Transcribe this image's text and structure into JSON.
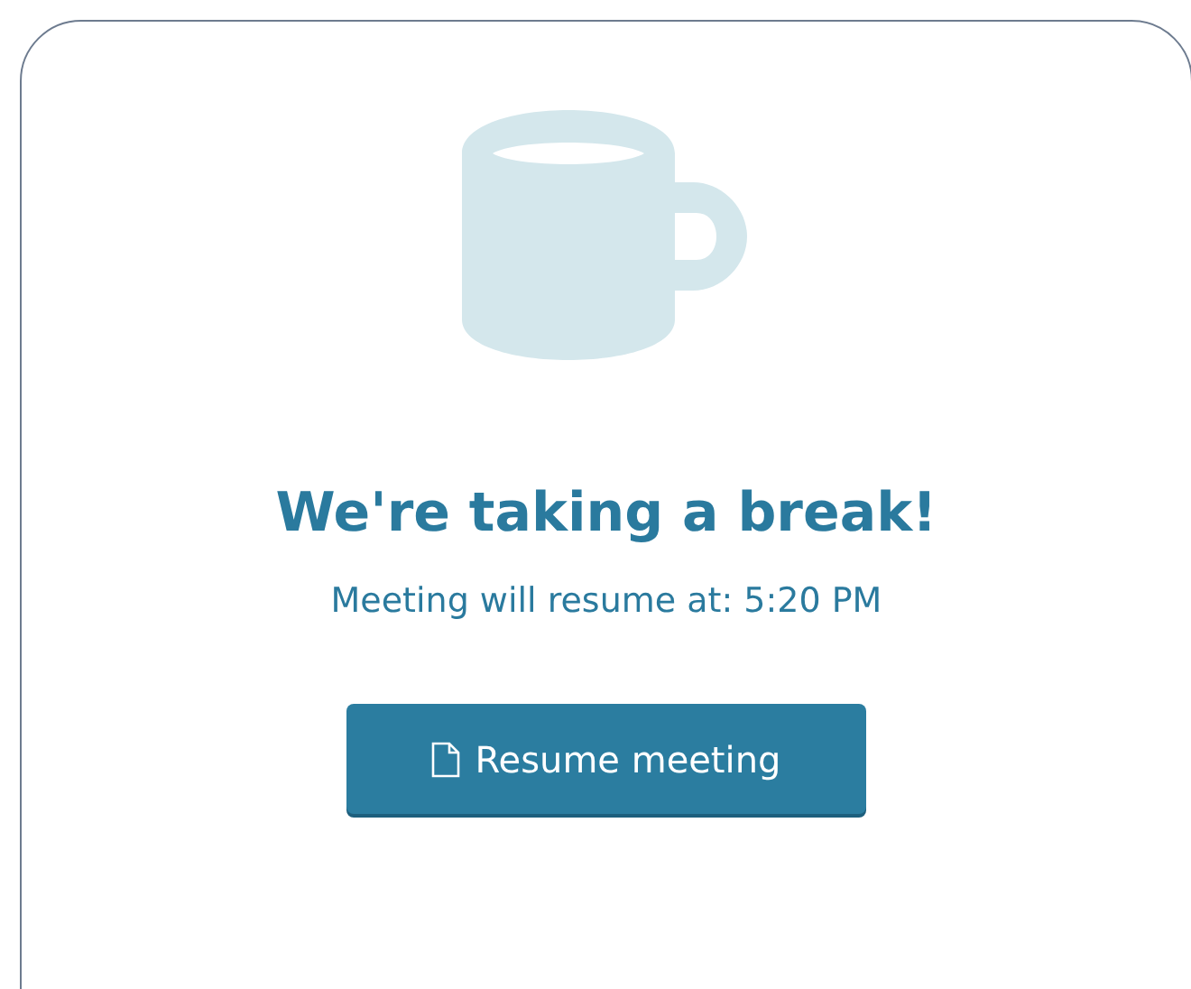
{
  "heading": "We're taking a break!",
  "message": "Meeting will resume at: 5:20 PM",
  "button": {
    "label": "Resume meeting"
  }
}
